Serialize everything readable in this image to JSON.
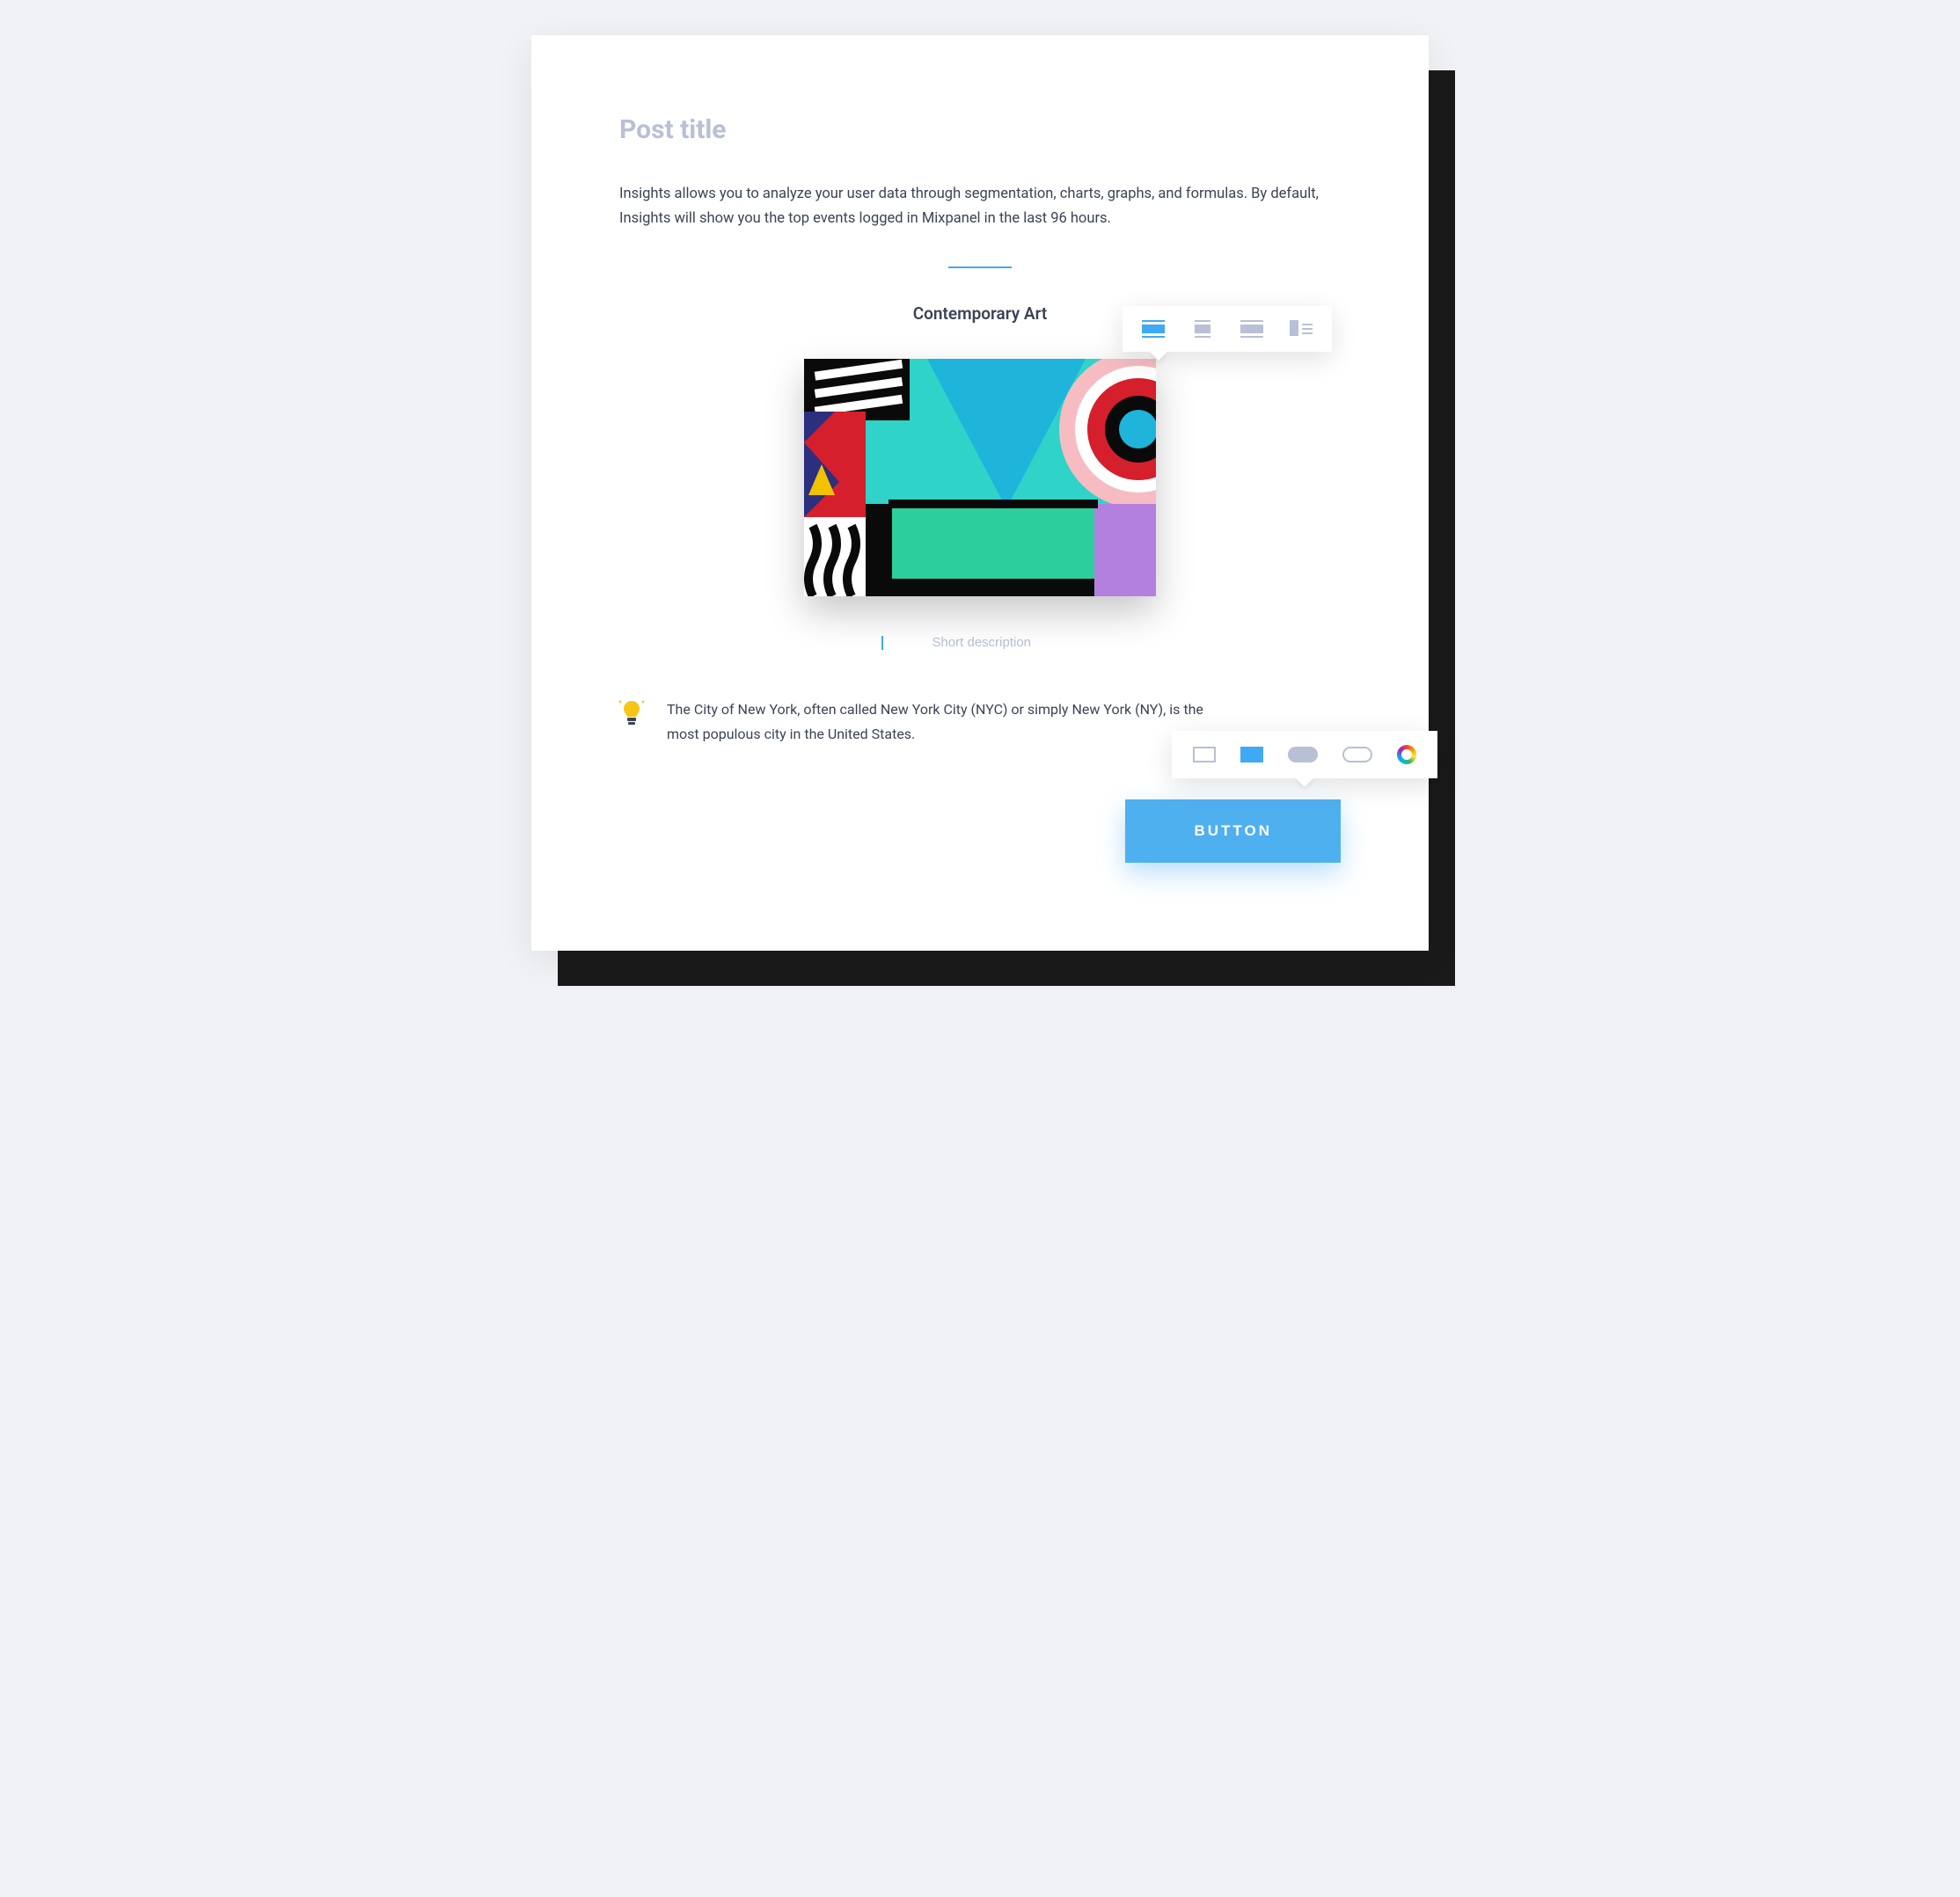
{
  "post_title": "Post title",
  "intro_text": "Insights allows you to analyze your user data through segmentation, charts, graphs, and formulas. By default, Insights will show you the top events logged in Mixpanel in the last 96 hours.",
  "section_heading": "Contemporary Art",
  "short_description_placeholder": "Short description",
  "tip_text": "The City of New York, often called New York City (NYC) or simply New York (NY), is the most populous city in the United States.",
  "button_label": "BUTTON",
  "layout_options": {
    "fullwidth": "full-width-layout",
    "center": "centered-layout",
    "wide": "wide-layout",
    "left": "left-align-layout"
  },
  "style_options": {
    "square_outline": "square-outline-style",
    "square_fill": "square-fill-style",
    "pill_fill": "pill-fill-style",
    "pill_outline": "pill-outline-style",
    "color": "color-picker"
  },
  "colors": {
    "accent": "#3fa9f5",
    "muted": "#b8c0d6",
    "text": "#3b4456"
  }
}
